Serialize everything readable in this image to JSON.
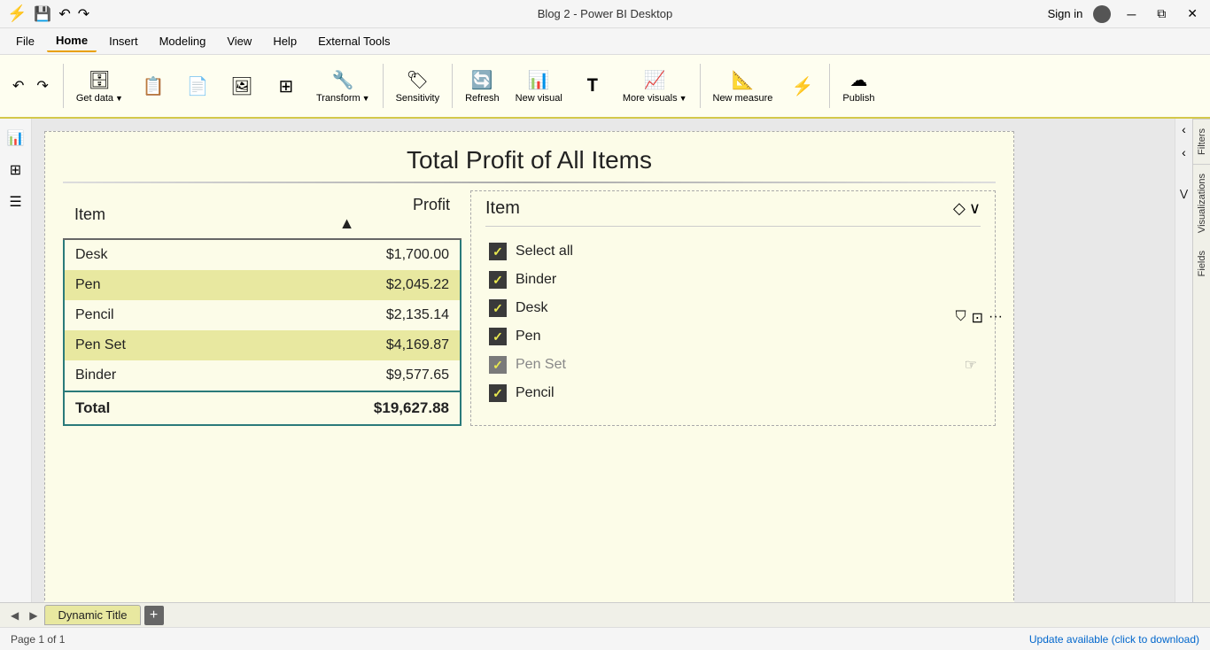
{
  "titlebar": {
    "title": "Blog 2 - Power BI Desktop",
    "sign_in": "Sign in"
  },
  "menu": {
    "items": [
      "File",
      "Home",
      "Insert",
      "Modeling",
      "View",
      "Help",
      "External Tools"
    ],
    "active": "Home"
  },
  "ribbon": {
    "undo_label": "↶",
    "redo_label": "↷",
    "buttons": [
      {
        "label": "Get data",
        "icon": "🗄"
      },
      {
        "label": "Refresh",
        "icon": "🔄"
      },
      {
        "label": "New visual",
        "icon": "📊"
      },
      {
        "label": "More visuals",
        "icon": "📈"
      },
      {
        "label": "New measure",
        "icon": "📐"
      },
      {
        "label": "Publish",
        "icon": "☁"
      }
    ]
  },
  "visual": {
    "title": "Total Profit of All Items",
    "table": {
      "headers": [
        "Item",
        "Profit"
      ],
      "rows": [
        {
          "item": "Desk",
          "profit": "$1,700.00",
          "highlighted": false
        },
        {
          "item": "Pen",
          "profit": "$2,045.22",
          "highlighted": true
        },
        {
          "item": "Pencil",
          "profit": "$2,135.14",
          "highlighted": false
        },
        {
          "item": "Pen Set",
          "profit": "$4,169.87",
          "highlighted": true
        },
        {
          "item": "Binder",
          "profit": "$9,577.65",
          "highlighted": false
        }
      ],
      "total_label": "Total",
      "total_value": "$19,627.88"
    },
    "slicer": {
      "title": "Item",
      "items": [
        {
          "label": "Select all",
          "checked": true,
          "muted": false
        },
        {
          "label": "Binder",
          "checked": true,
          "muted": false
        },
        {
          "label": "Desk",
          "checked": true,
          "muted": false
        },
        {
          "label": "Pen",
          "checked": true,
          "muted": false
        },
        {
          "label": "Pen Set",
          "checked": true,
          "muted": true
        },
        {
          "label": "Pencil",
          "checked": true,
          "muted": false
        }
      ]
    }
  },
  "right_panels": {
    "collapse_label": "‹",
    "back_label": "‹",
    "filters_label": "Filters",
    "visualizations_label": "Visualizations",
    "fields_label": "Fields"
  },
  "page_tabs": {
    "tabs": [
      "Dynamic Title"
    ],
    "add_label": "+"
  },
  "status": {
    "left": "Page 1 of 1",
    "right": "Update available (click to download)"
  },
  "sidebar": {
    "icons": [
      "📊",
      "⊞",
      "☰"
    ]
  }
}
